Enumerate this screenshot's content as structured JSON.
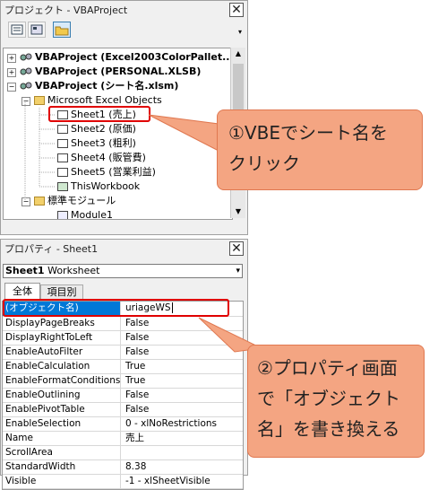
{
  "project_pane": {
    "title": "プロジェクト - VBAProject",
    "tree": {
      "project1": "VBAProject (Excel2003ColorPallet...",
      "project2": "VBAProject (PERSONAL.XLSB)",
      "project3": "VBAProject (シート名.xlsm)",
      "folder_objects": "Microsoft Excel Objects",
      "sheets": [
        "Sheet1 (売上)",
        "Sheet2 (原価)",
        "Sheet3 (粗利)",
        "Sheet4 (販管費)",
        "Sheet5 (営業利益)"
      ],
      "workbook": "ThisWorkbook",
      "folder_modules": "標準モジュール",
      "module1": "Module1"
    }
  },
  "properties_pane": {
    "title": "プロパティ - Sheet1",
    "object_selector": {
      "name": "Sheet1",
      "type": "Worksheet"
    },
    "tabs": [
      "全体",
      "項目別"
    ],
    "rows": [
      {
        "name": "(オブジェクト名)",
        "value": "uriageWS"
      },
      {
        "name": "DisplayPageBreaks",
        "value": "False"
      },
      {
        "name": "DisplayRightToLeft",
        "value": "False"
      },
      {
        "name": "EnableAutoFilter",
        "value": "False"
      },
      {
        "name": "EnableCalculation",
        "value": "True"
      },
      {
        "name": "EnableFormatConditionsC",
        "value": "True"
      },
      {
        "name": "EnableOutlining",
        "value": "False"
      },
      {
        "name": "EnablePivotTable",
        "value": "False"
      },
      {
        "name": "EnableSelection",
        "value": "0 - xlNoRestrictions"
      },
      {
        "name": "Name",
        "value": "売上"
      },
      {
        "name": "ScrollArea",
        "value": ""
      },
      {
        "name": "StandardWidth",
        "value": "8.38"
      },
      {
        "name": "Visible",
        "value": "-1 - xlSheetVisible"
      }
    ]
  },
  "callouts": {
    "c1": {
      "line1": "①VBEでシート名を",
      "line2": "クリック"
    },
    "c2": {
      "line1": "②プロパティ画面",
      "line2": "で「オブジェクト",
      "line3": "名」を書き換える"
    }
  },
  "colors": {
    "callout_fill": "#f4a582",
    "highlight_red": "#e00000",
    "selection_blue": "#0078d7"
  }
}
